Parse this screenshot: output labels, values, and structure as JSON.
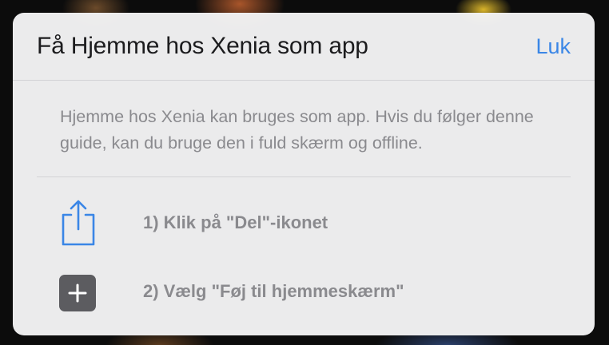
{
  "modal": {
    "title": "Få Hjemme hos Xenia som app",
    "close_label": "Luk",
    "description": "Hjemme hos Xenia kan bruges som app. Hvis du følger denne guide, kan du bruge den i fuld skærm og offline.",
    "steps": [
      {
        "icon": "share-icon",
        "label": "1) Klik på \"Del\"-ikonet"
      },
      {
        "icon": "add-square-icon",
        "label": "2) Vælg \"Føj til hjemmeskærm\""
      }
    ]
  },
  "colors": {
    "accent": "#3a86e6",
    "text_primary": "#1c1c1e",
    "text_secondary": "#8a8a8e",
    "modal_bg": "#f3f3f4",
    "plus_box": "#5c5c60"
  }
}
